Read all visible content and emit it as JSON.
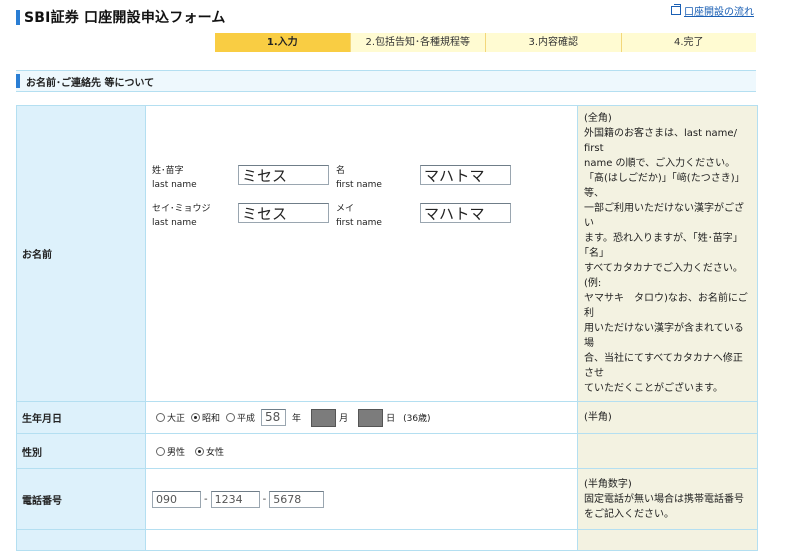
{
  "header": {
    "title": "SBI証券 口座開設申込フォーム",
    "flow_link": "口座開設の流れ"
  },
  "steps": [
    {
      "label": "1.入力",
      "active": true
    },
    {
      "label": "2.包括告知･各種規程等",
      "active": false
    },
    {
      "label": "3.内容確認",
      "active": false
    },
    {
      "label": "4.完了",
      "active": false
    }
  ],
  "section": {
    "title": "お名前･ご連絡先 等について"
  },
  "name_row": {
    "label": "お名前",
    "sei_label": "姓･苗字",
    "sei_sub": "last name",
    "sei_value": "ミセス",
    "mei_label": "名",
    "mei_sub": "first name",
    "mei_value": "マハトマ",
    "sei_kana_label": "セイ･ミョウジ",
    "sei_kana_sub": "last name",
    "sei_kana_value": "ミセス",
    "mei_kana_label": "メイ",
    "mei_kana_sub": "first name",
    "mei_kana_value": "マハトマ",
    "note": [
      "(全角)",
      "外国籍のお客さまは、last name/ first",
      "name の順で、ご入力ください。",
      "「髙(はしごだか)」｢﨑(たつさき)｣等、",
      "一部ご利用いただけない漢字がござい",
      "ます。恐れ入りますが、「姓･苗字」｢名｣",
      "すべてカタカナでご入力ください。(例:",
      "ヤマサキ　タロウ)なお、お名前にご利",
      "用いただけない漢字が含まれている場",
      "合、当社にてすべてカタカナへ修正させ",
      "ていただくことがございます。"
    ]
  },
  "birth_row": {
    "label": "生年月日",
    "eras": [
      {
        "label": "大正",
        "selected": false
      },
      {
        "label": "昭和",
        "selected": true
      },
      {
        "label": "平成",
        "selected": false
      }
    ],
    "year_value": "58",
    "year_unit": "年",
    "month_unit": "月",
    "day_unit": "日",
    "age": "(36歳)",
    "note": "(半角)"
  },
  "sex_row": {
    "label": "性別",
    "options": [
      {
        "label": "男性",
        "selected": false
      },
      {
        "label": "女性",
        "selected": true
      }
    ]
  },
  "tel_row": {
    "label": "電話番号",
    "part1": "090",
    "part2": "1234",
    "part3": "5678",
    "dash": "-",
    "note": [
      "(半角数字)",
      "固定電話が無い場合は携帯電話番号",
      "をご記入ください。"
    ]
  },
  "colors": {
    "accent_blue": "#2a7ed4",
    "step_active": "#f9cd43",
    "step_inactive": "#fffbd2",
    "label_bg": "#ddf1fb",
    "note_bg": "#f3f2e1",
    "border": "#b4dff1"
  }
}
